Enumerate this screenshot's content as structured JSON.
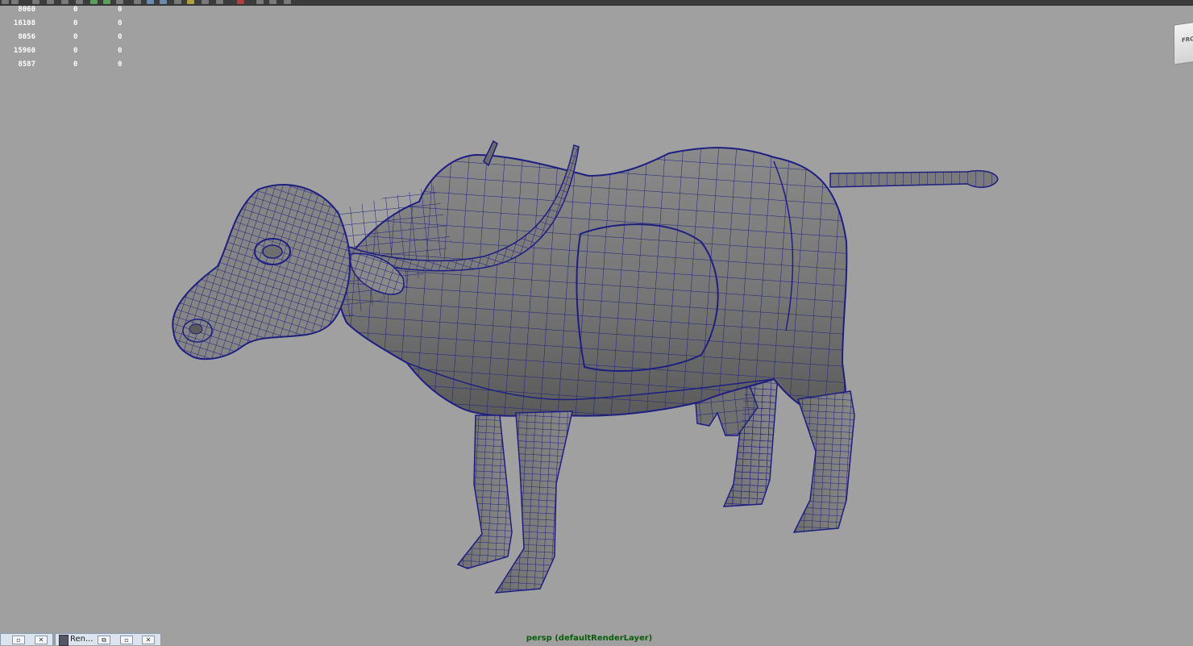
{
  "hud": {
    "rows": [
      {
        "v0": "8060",
        "v1": "0",
        "v2": "0"
      },
      {
        "v0": "16108",
        "v1": "0",
        "v2": "0"
      },
      {
        "v0": "8056",
        "v1": "0",
        "v2": "0"
      },
      {
        "v0": "15960",
        "v1": "0",
        "v2": "0"
      },
      {
        "v0": "8587",
        "v1": "0",
        "v2": "0"
      }
    ]
  },
  "viewport": {
    "camera_label": "persp (defaultRenderLayer)",
    "background_color": "#a0a0a0",
    "wire_color": "#1e1e82",
    "mesh_color": "#747474"
  },
  "viewcube": {
    "label": "FRONT"
  },
  "taskbar": {
    "panel_title": "Ren..."
  },
  "icons": {
    "restore": "restore-icon",
    "close": "close-icon",
    "render": "render-view-icon",
    "viewcube": "viewcube-icon"
  }
}
